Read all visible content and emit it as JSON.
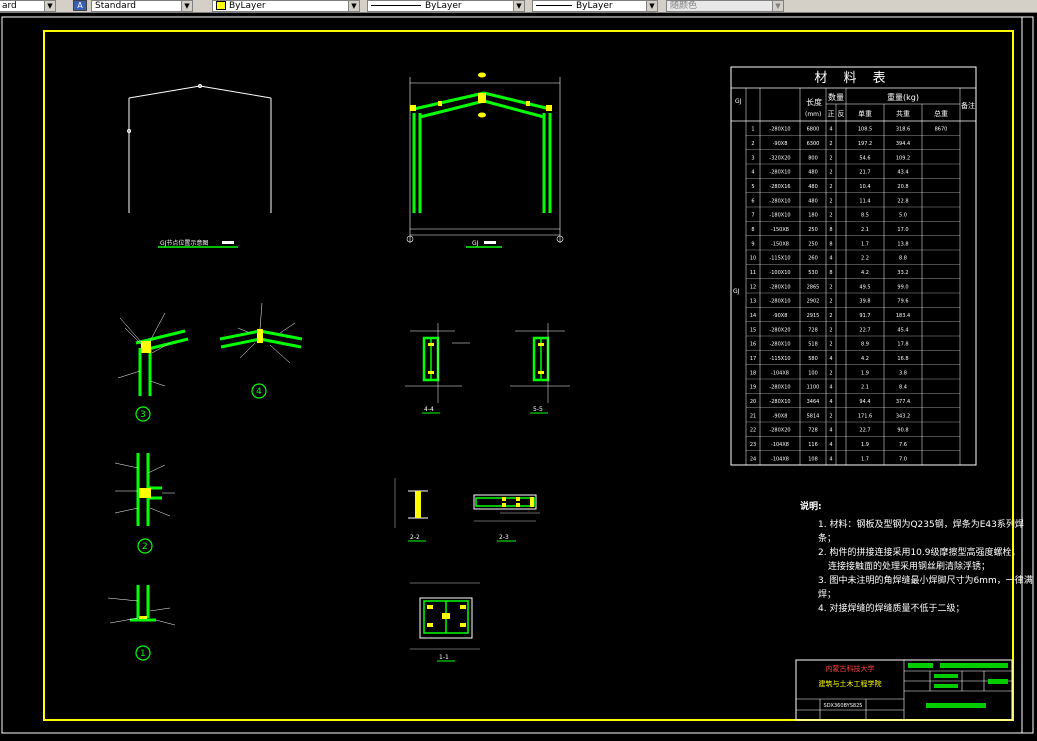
{
  "toolbar": {
    "layer_state": "ard",
    "text_style": "Standard",
    "color": "ByLayer",
    "linetype": "ByLayer",
    "lineweight": "ByLayer",
    "plot_style": "随颜色"
  },
  "drawing": {
    "gj_title": "GJ",
    "gj_node_title": "GJ节点位置示意图",
    "sections": [
      "4-4",
      "5-5",
      "2-2",
      "2-3",
      "1-1"
    ],
    "details": [
      "3",
      "4",
      "2",
      "1"
    ]
  },
  "material_table": {
    "title": "材 料 表",
    "header_length": "长度",
    "header_length_unit": "(mm)",
    "header_qty": "数量",
    "header_qty_pos": "正",
    "header_qty_neg": "反",
    "header_weight": "重量(kg)",
    "header_unit_wt": "单重",
    "header_total_wt": "共重",
    "header_sum": "总重",
    "header_note": "备注",
    "member_label": "GJ",
    "rows": [
      [
        "1",
        "-280X10",
        "6800",
        "4",
        "",
        "108.5",
        "318.6",
        "8670"
      ],
      [
        "2",
        "-90X8",
        "6300",
        "2",
        "",
        "197.2",
        "394.4",
        ""
      ],
      [
        "3",
        "-320X20",
        "800",
        "2",
        "",
        "54.6",
        "109.2",
        ""
      ],
      [
        "4",
        "-280X10",
        "480",
        "2",
        "",
        "21.7",
        "43.4",
        ""
      ],
      [
        "5",
        "-280X16",
        "480",
        "2",
        "",
        "10.4",
        "20.8",
        ""
      ],
      [
        "6",
        "-280X10",
        "480",
        "2",
        "",
        "11.4",
        "22.8",
        ""
      ],
      [
        "7",
        "-180X10",
        "180",
        "2",
        "",
        "8.5",
        "5.0",
        ""
      ],
      [
        "8",
        "-150X8",
        "250",
        "8",
        "",
        "2.1",
        "17.0",
        ""
      ],
      [
        "9",
        "-150X8",
        "250",
        "8",
        "",
        "1.7",
        "13.8",
        ""
      ],
      [
        "10",
        "-115X10",
        "260",
        "4",
        "",
        "2.2",
        "8.8",
        ""
      ],
      [
        "11",
        "-100X10",
        "530",
        "8",
        "",
        "4.2",
        "33.2",
        ""
      ],
      [
        "12",
        "-280X10",
        "2865",
        "2",
        "",
        "49.5",
        "99.0",
        ""
      ],
      [
        "13",
        "-280X10",
        "2902",
        "2",
        "",
        "39.8",
        "79.6",
        ""
      ],
      [
        "14",
        "-90X8",
        "2915",
        "2",
        "",
        "91.7",
        "183.4",
        ""
      ],
      [
        "15",
        "-280X20",
        "728",
        "2",
        "",
        "22.7",
        "45.4",
        ""
      ],
      [
        "16",
        "-280X10",
        "518",
        "2",
        "",
        "8.9",
        "17.8",
        ""
      ],
      [
        "17",
        "-115X10",
        "580",
        "4",
        "",
        "4.2",
        "16.8",
        ""
      ],
      [
        "18",
        "-104X8",
        "100",
        "2",
        "",
        "1.9",
        "3.8",
        ""
      ],
      [
        "19",
        "-280X10",
        "1100",
        "4",
        "",
        "2.1",
        "8.4",
        ""
      ],
      [
        "20",
        "-280X10",
        "3464",
        "4",
        "",
        "94.4",
        "377.4",
        ""
      ],
      [
        "21",
        "-90X8",
        "5814",
        "2",
        "",
        "171.6",
        "343.2",
        ""
      ],
      [
        "22",
        "-280X20",
        "728",
        "4",
        "",
        "22.7",
        "90.8",
        ""
      ],
      [
        "23",
        "-104X8",
        "116",
        "4",
        "",
        "1.9",
        "7.6",
        ""
      ],
      [
        "24",
        "-104X8",
        "108",
        "4",
        "",
        "1.7",
        "7.0",
        ""
      ]
    ]
  },
  "notes": {
    "title": "说明:",
    "items": [
      "1. 材料：钢板及型钢为Q235钢，焊条为E43系列焊条；",
      "2. 构件的拼接连接采用10.9级摩擦型高强度螺栓，",
      "连接接触面的处理采用钢丝刷清除浮锈；",
      "3. 图中未注明的角焊缝最小焊脚尺寸为6mm，一律满焊；",
      "4. 对接焊缝的焊缝质量不低于二级；"
    ]
  },
  "title_block": {
    "university": "内蒙古科技大学",
    "school": "建筑与土木工程学院",
    "drawing_no": "SDX360BYS825"
  },
  "colors": {
    "border": "#ffff00",
    "member": "#00ff00",
    "line": "#ffffff",
    "text_red": "#ff4040",
    "accent_green": "#00cc00"
  }
}
